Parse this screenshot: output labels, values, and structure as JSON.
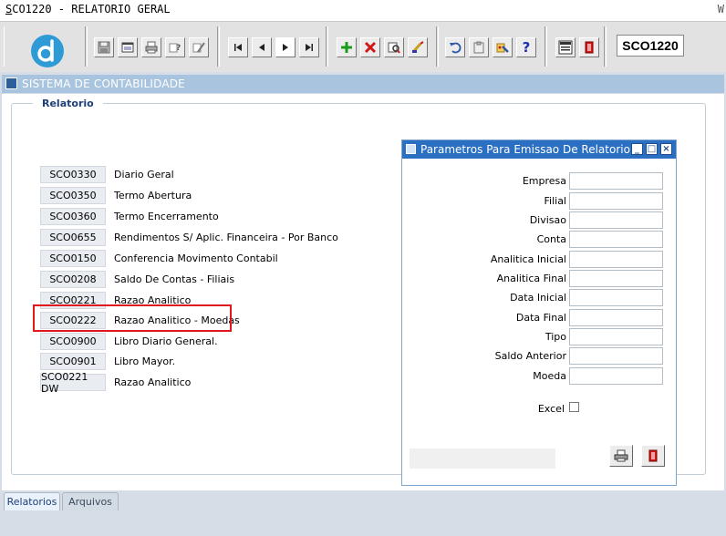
{
  "window": {
    "title_prefix": "S",
    "title_rest": "CO1220 - RELATORIO GERAL",
    "right_fragment": "W"
  },
  "toolbar": {
    "form_code": "SCO1220",
    "icons": [
      "app-logo",
      "save-icon",
      "window-icon",
      "print-icon",
      "help-query-icon",
      "edit-query-icon",
      "first-record-icon",
      "prev-record-icon",
      "next-record-icon",
      "last-record-icon",
      "insert-record-icon",
      "delete-record-icon",
      "query-record-icon",
      "clear-record-icon",
      "undo-icon",
      "paste-icon",
      "tools-icon",
      "help-icon",
      "menu-icon",
      "exit-icon"
    ]
  },
  "app_window": {
    "title": "SISTEMA DE CONTABILIDADE"
  },
  "main": {
    "frame_label": "Relatorio",
    "reports": [
      {
        "code": "SCO0330",
        "label": "Diario Geral"
      },
      {
        "code": "SCO0350",
        "label": "Termo Abertura"
      },
      {
        "code": "SCO0360",
        "label": "Termo Encerramento"
      },
      {
        "code": "SCO0655",
        "label": "Rendimentos S/ Aplic. Financeira - Por Banco"
      },
      {
        "code": "SCO0150",
        "label": "Conferencia Movimento Contabil"
      },
      {
        "code": "SCO0208",
        "label": "Saldo De Contas - Filiais"
      },
      {
        "code": "SCO0221",
        "label": "Razao Analitico"
      },
      {
        "code": "SCO0222",
        "label": "Razao Analitico - Moedas"
      },
      {
        "code": "SCO0900",
        "label": "Libro Diario General."
      },
      {
        "code": "SCO0901",
        "label": "Libro Mayor."
      },
      {
        "code": "SCO0221 DW",
        "label": "Razao Analitico"
      }
    ],
    "highlighted_code": "SCO0222"
  },
  "dialog": {
    "title": "Parametros Para Emissao De Relatorio",
    "fields": [
      {
        "label": "Empresa",
        "value": ""
      },
      {
        "label": "Filial",
        "value": ""
      },
      {
        "label": "Divisao",
        "value": ""
      },
      {
        "label": "Conta",
        "value": ""
      },
      {
        "label": "Analitica Inicial",
        "value": ""
      },
      {
        "label": "Analitica Final",
        "value": ""
      },
      {
        "label": "Data Inicial",
        "value": ""
      },
      {
        "label": "Data Final",
        "value": ""
      },
      {
        "label": "Tipo",
        "value": ""
      },
      {
        "label": "Saldo Anterior",
        "value": ""
      },
      {
        "label": "Moeda",
        "value": ""
      }
    ],
    "excel_label": "Excel",
    "excel_checked": false
  },
  "tabs": [
    {
      "label": "Relatorios",
      "active": true
    },
    {
      "label": "Arquivos",
      "active": false
    }
  ],
  "colors": {
    "highlight": "#e0181d",
    "dialog_title_bg": "#2b6fc3",
    "window_title_bg": "#a8c4de",
    "logo": "#2e9bd6"
  }
}
